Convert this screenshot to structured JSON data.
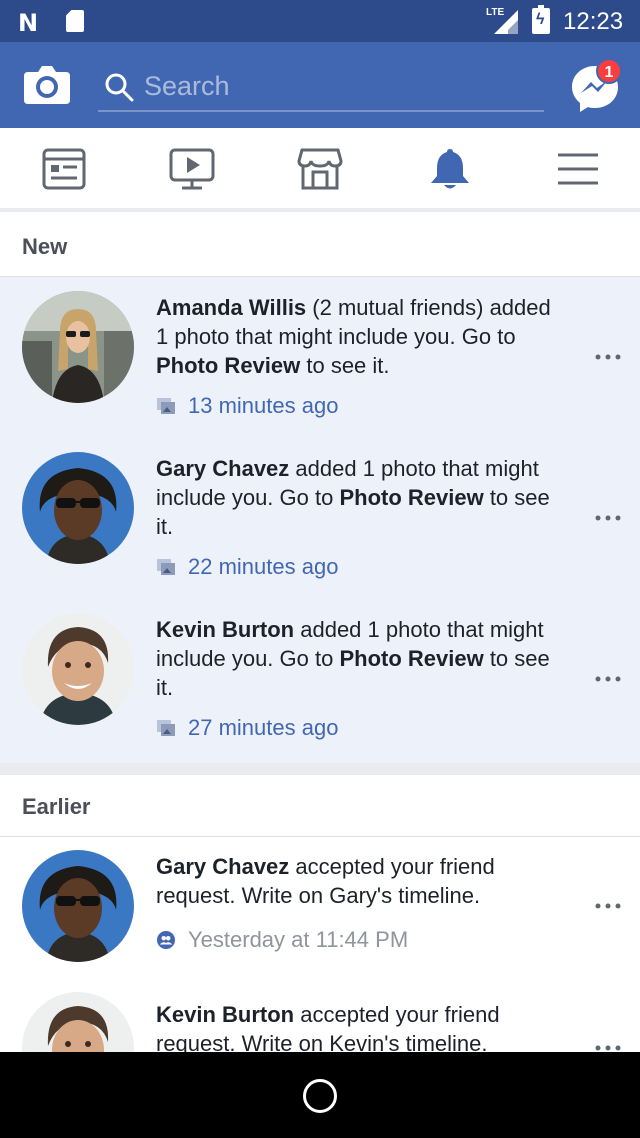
{
  "status_bar": {
    "network": "LTE",
    "time": "12:23"
  },
  "search": {
    "placeholder": "Search"
  },
  "messenger": {
    "badge_count": "1"
  },
  "nav_tabs": [
    {
      "name": "news-feed",
      "icon": "news-feed-icon",
      "active": false
    },
    {
      "name": "watch",
      "icon": "video-icon",
      "active": false
    },
    {
      "name": "marketplace",
      "icon": "marketplace-icon",
      "active": false
    },
    {
      "name": "notifications",
      "icon": "bell-icon",
      "active": true
    },
    {
      "name": "menu",
      "icon": "hamburger-menu-icon",
      "active": false
    }
  ],
  "sections": {
    "new": "New",
    "earlier": "Earlier"
  },
  "notifications": [
    {
      "name": "Amanda Willis",
      "after_name": " (2 mutual friends) added 1 photo that might include you. Go to ",
      "link": "Photo Review",
      "end": " to see it.",
      "time": "13 minutes ago",
      "time_icon": "photo-icon"
    },
    {
      "name": "Gary Chavez",
      "after_name": " added 1 photo that might include you. Go to ",
      "link": "Photo Review",
      "end": " to see it.",
      "time": "22 minutes ago",
      "time_icon": "photo-icon"
    },
    {
      "name": "Kevin Burton",
      "after_name": " added 1 photo that might include you. Go to ",
      "link": "Photo Review",
      "end": " to see it.",
      "time": "27 minutes ago",
      "time_icon": "photo-icon"
    },
    {
      "name": "Gary Chavez",
      "after_name": " accepted your friend request. Write on Gary's timeline.",
      "time": "Yesterday at 11:44 PM",
      "time_icon": "friends-icon"
    },
    {
      "name": "Kevin Burton",
      "after_name": " accepted your friend request. Write on Kevin's timeline."
    }
  ],
  "colors": {
    "brand": "#4267b2",
    "status_bar": "#2d4a8a",
    "unread_bg": "#edf2fa",
    "badge": "#fa3e3e"
  }
}
